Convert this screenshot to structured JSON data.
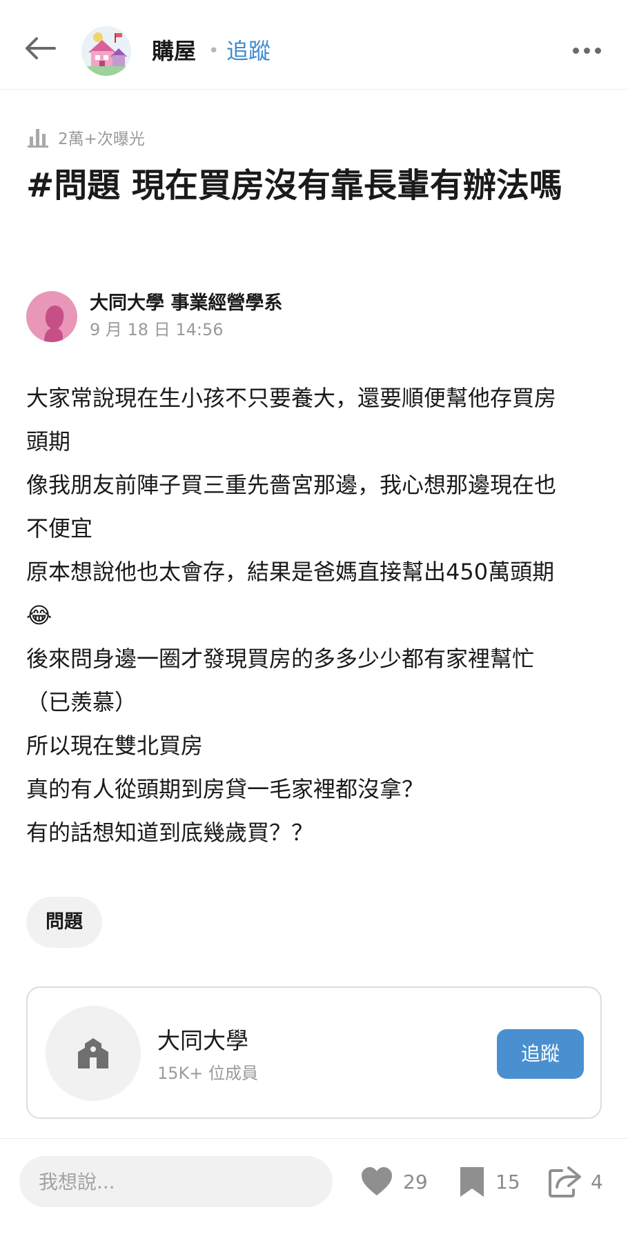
{
  "header": {
    "forum_name": "購屋",
    "separator": "•",
    "follow_label": "追蹤"
  },
  "post": {
    "views": "2萬+次曝光",
    "title": "#問題 現在買房沒有靠長輩有辦法嗎",
    "author": "大同大學 事業經營學系",
    "timestamp": "9 月 18 日 14:56",
    "body_lines": [
      "大家常說現在生小孩不只要養大，還要順便幫他存買房",
      "頭期",
      "像我朋友前陣子買三重先嗇宮那邊，我心想那邊現在也",
      "不便宜",
      "原本想說他也太會存，結果是爸媽直接幫出450萬頭期",
      "😂",
      "後來問身邊一圈才發現買房的多多少少都有家裡幫忙",
      "（已羨慕）",
      "所以現在雙北買房",
      "真的有人從頭期到房貸一毛家裡都沒拿？",
      "有的話想知道到底幾歲買？？"
    ],
    "tag": "問題"
  },
  "board": {
    "name": "大同大學",
    "members": "15K+ 位成員",
    "follow_label": "追蹤"
  },
  "bottom_bar": {
    "comment_placeholder": "我想說...",
    "like_count": "29",
    "save_count": "15",
    "share_count": "4"
  },
  "colors": {
    "accent": "#3d8bd1",
    "follow_button": "#4a90d0",
    "author_avatar": "#e897b8",
    "muted_text": "#9a9a9a"
  },
  "icons": {
    "back": "arrow-left-icon",
    "more": "more-dots-icon",
    "views": "bar-chart-icon",
    "board": "building-icon",
    "like": "heart-icon",
    "save": "bookmark-icon",
    "share": "share-icon"
  }
}
